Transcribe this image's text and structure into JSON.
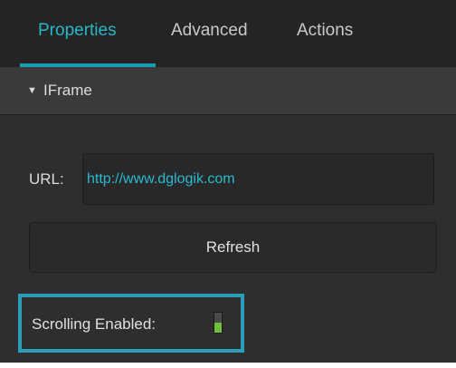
{
  "tabs": [
    {
      "label": "Properties",
      "active": true
    },
    {
      "label": "Advanced",
      "active": false
    },
    {
      "label": "Actions",
      "active": false
    }
  ],
  "section": {
    "caret_icon": "triangle-down-icon",
    "caret_glyph": "▼",
    "title": "IFrame"
  },
  "url": {
    "label": "URL:",
    "value": "http://www.dglogik.com"
  },
  "refresh_label": "Refresh",
  "scrolling": {
    "label": "Scrolling Enabled:",
    "enabled": true
  },
  "colors": {
    "accent": "#27b5c9",
    "highlight": "#2aa0b8",
    "toggle_on": "#6fbf3c"
  }
}
